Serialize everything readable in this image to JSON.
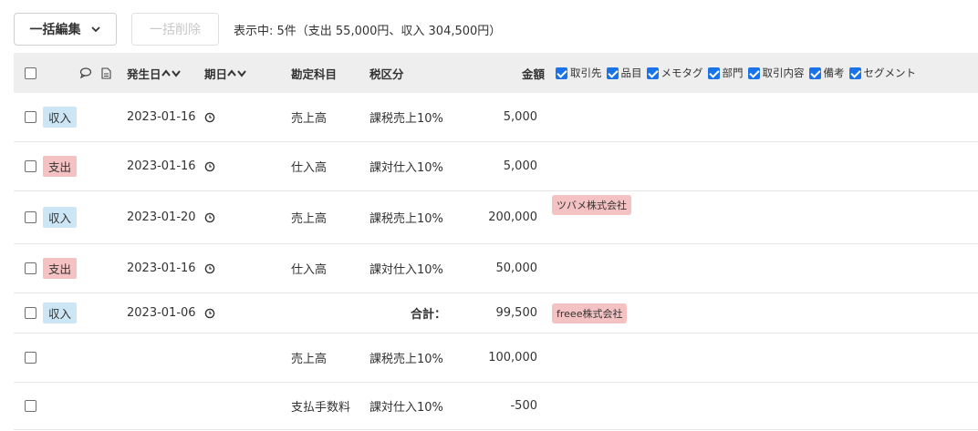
{
  "toolbar": {
    "bulk_edit_label": "一括編集",
    "bulk_delete_label": "一括削除",
    "summary": "表示中: 5件（支出 55,000円、収入 304,500円）"
  },
  "header": {
    "issue_date": "発生日",
    "due_date": "期日",
    "account": "勘定科目",
    "tax": "税区分",
    "amount": "金額",
    "filters": [
      "取引先",
      "品目",
      "メモタグ",
      "部門",
      "取引内容",
      "備考",
      "セグメント"
    ]
  },
  "rows": [
    {
      "type": "収入",
      "kind": "income",
      "date": "2023-01-16",
      "account": "売上高",
      "tax": "課税売上10%",
      "amount": "5,000",
      "tag": ""
    },
    {
      "type": "支出",
      "kind": "expense",
      "date": "2023-01-16",
      "account": "仕入高",
      "tax": "課対仕入10%",
      "amount": "5,000",
      "tag": ""
    },
    {
      "type": "収入",
      "kind": "income",
      "date": "2023-01-20",
      "account": "売上高",
      "tax": "課税売上10%",
      "amount": "200,000",
      "tag": "ツバメ株式会社"
    },
    {
      "type": "支出",
      "kind": "expense",
      "date": "2023-01-16",
      "account": "仕入高",
      "tax": "課対仕入10%",
      "amount": "50,000",
      "tag": ""
    },
    {
      "type": "収入",
      "kind": "income",
      "date": "2023-01-06",
      "account": "",
      "tax": "合計：",
      "amount": "99,500",
      "tag": "freee株式会社"
    },
    {
      "type": "",
      "kind": "",
      "date": "",
      "account": "売上高",
      "tax": "課税売上10%",
      "amount": "100,000",
      "tag": ""
    },
    {
      "type": "",
      "kind": "",
      "date": "",
      "account": "支払手数料",
      "tax": "課対仕入10%",
      "amount": "-500",
      "tag": ""
    }
  ]
}
